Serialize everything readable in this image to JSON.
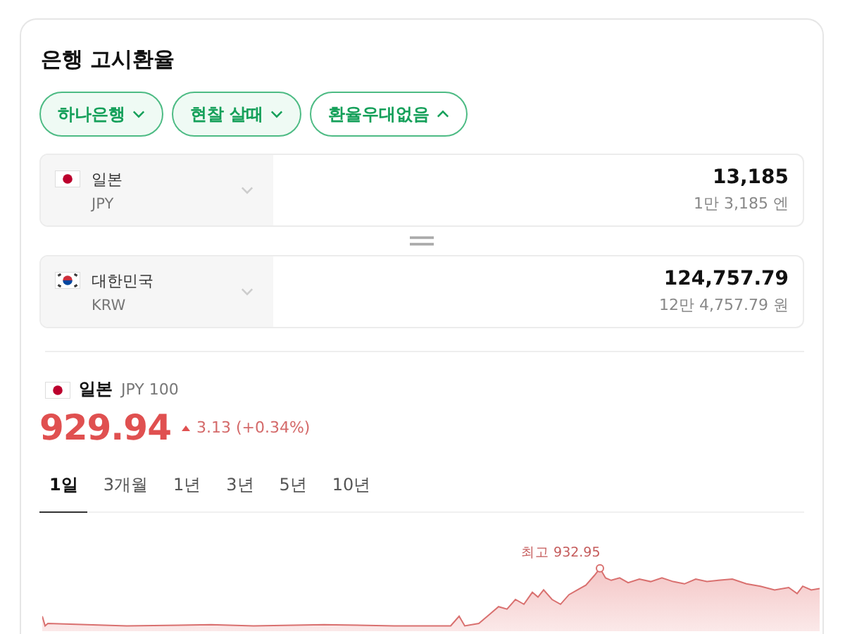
{
  "card": {
    "title": "은행 고시환율",
    "filters": [
      {
        "label": "하나은행",
        "selected": true,
        "expanded": false
      },
      {
        "label": "현찰 살때",
        "selected": true,
        "expanded": false
      },
      {
        "label": "환율우대없음",
        "selected": false,
        "expanded": true
      }
    ],
    "converter": [
      {
        "kind": "japan",
        "country": "일본",
        "code": "JPY",
        "amount": "13,185",
        "amount_words": "1만 3,185 엔"
      },
      {
        "kind": "korea",
        "country": "대한민국",
        "code": "KRW",
        "amount": "124,757.79",
        "amount_words": "12만 4,757.79 원"
      }
    ],
    "rate": {
      "kind": "japan",
      "country": "일본",
      "unit": "JPY 100",
      "value": "929.94",
      "change": "3.13 (+0.34%)",
      "rising": true
    },
    "periods": [
      {
        "label": "1일",
        "selected": true
      },
      {
        "label": "3개월",
        "selected": false
      },
      {
        "label": "1년",
        "selected": false
      },
      {
        "label": "3년",
        "selected": false
      },
      {
        "label": "5년",
        "selected": false
      },
      {
        "label": "10년",
        "selected": false
      }
    ],
    "chart_high_label": "최고 932.95"
  }
}
